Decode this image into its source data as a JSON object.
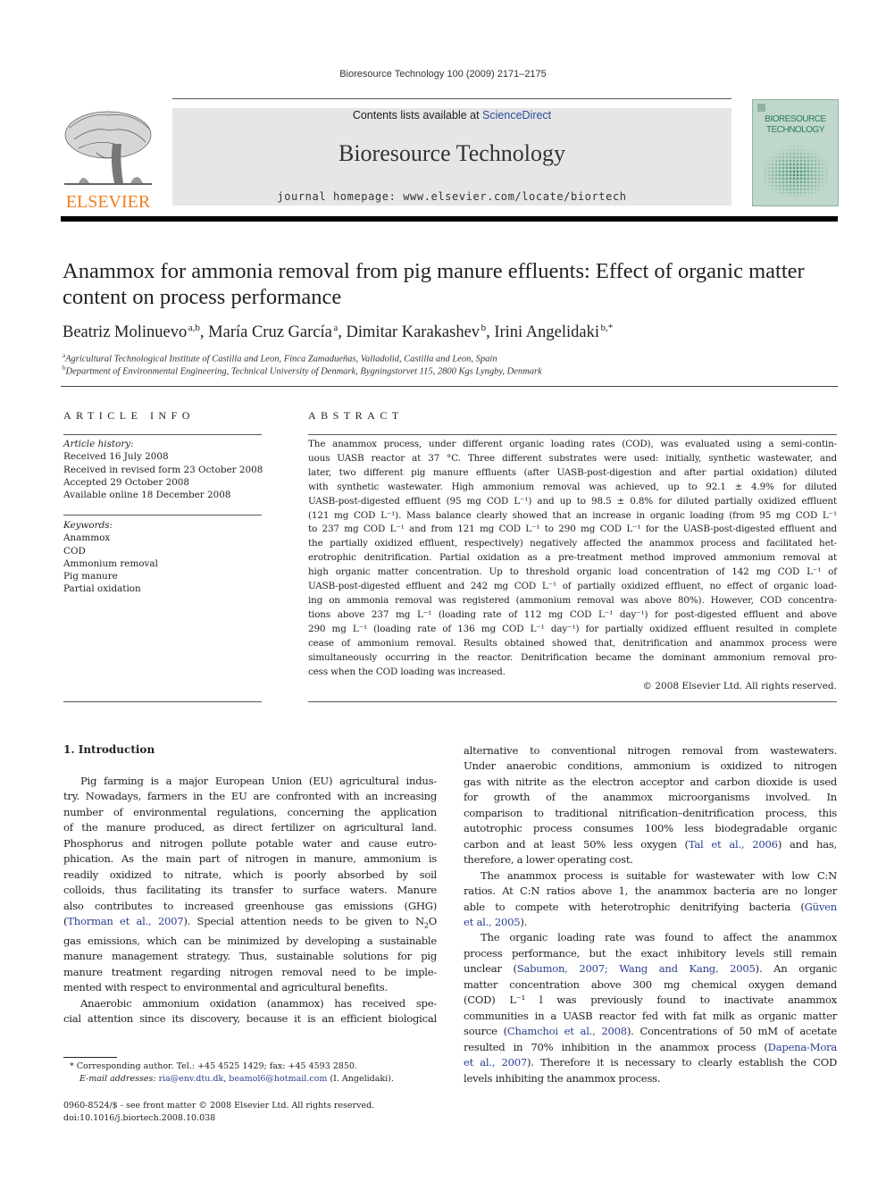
{
  "running_head": "Bioresource Technology 100 (2009) 2171–2175",
  "masthead": {
    "contents_prefix": "Contents lists available at ",
    "contents_link": "ScienceDirect",
    "journal_name": "Bioresource Technology",
    "homepage": "journal homepage: www.elsevier.com/locate/biortech",
    "publisher_logo_text": "ELSEVIER",
    "cover_title_line1": "BIORESOURCE",
    "cover_title_line2": "TECHNOLOGY",
    "colors": {
      "elsevier_orange": "#f07f1d",
      "link_blue": "#2a4b9b",
      "cover_green": "#bfd8cb"
    }
  },
  "article": {
    "title": "Anammox for ammonia removal from pig manure effluents: Effect of organic matter content on process performance",
    "authors": [
      {
        "name": "Beatriz Molinuevo",
        "sup": "a,b",
        "sep": ", "
      },
      {
        "name": "María Cruz García",
        "sup": "a",
        "sep": ", "
      },
      {
        "name": "Dimitar Karakashev",
        "sup": "b",
        "sep": ", "
      },
      {
        "name": "Irini Angelidaki",
        "sup": "b,*",
        "sep": ""
      }
    ],
    "affiliations": [
      {
        "mark": "a",
        "text": "Agricultural Technological Institute of Castilla and Leon, Finca Zamadueñas, Valladolid, Castilla and Leon, Spain"
      },
      {
        "mark": "b",
        "text": "Department of Environmental Engineering, Technical University of Denmark, Bygningstorvet 115, 2800 Kgs Lyngby, Denmark"
      }
    ]
  },
  "article_info": {
    "label": "ARTICLE INFO",
    "history_label": "Article history:",
    "history": [
      "Received 16 July 2008",
      "Received in revised form 23 October 2008",
      "Accepted 29 October 2008",
      "Available online 18 December 2008"
    ],
    "keywords_label": "Keywords:",
    "keywords": [
      "Anammox",
      "COD",
      "Ammonium removal",
      "Pig manure",
      "Partial oxidation"
    ]
  },
  "abstract": {
    "label": "ABSTRACT",
    "lines": [
      "The anammox process, under different organic loading rates (COD), was evaluated using a semi-contin-",
      "uous UASB reactor at 37 °C. Three different substrates were used: initially, synthetic wastewater, and",
      "later, two different pig manure effluents (after UASB-post-digestion and after partial oxidation) diluted",
      "with synthetic wastewater. High ammonium removal was achieved, up to 92.1 ± 4.9% for diluted",
      "UASB-post-digested effluent (95 mg COD L⁻¹) and up to 98.5 ± 0.8% for diluted partially oxidized effluent",
      "(121 mg COD L⁻¹). Mass balance clearly showed that an increase in organic loading (from 95 mg COD L⁻¹",
      "to 237 mg COD L⁻¹ and from 121 mg COD L⁻¹ to 290 mg COD L⁻¹ for the UASB-post-digested effluent and",
      "the partially oxidized effluent, respectively) negatively affected the anammox process and facilitated het-",
      "erotrophic denitrification. Partial oxidation as a pre-treatment method improved ammonium removal at",
      "high organic matter concentration. Up to threshold organic load concentration of 142 mg COD L⁻¹ of",
      "UASB-post-digested effluent and 242 mg COD L⁻¹ of partially oxidized effluent, no effect of organic load-",
      "ing on ammonia removal was registered (ammonium removal was above 80%). However, COD concentra-",
      "tions above 237 mg L⁻¹ (loading rate of 112 mg COD L⁻¹ day⁻¹) for post-digested effluent and above",
      "290 mg L⁻¹ (loading rate of 136 mg COD L⁻¹ day⁻¹) for partially oxidized effluent resulted in complete",
      "cease of ammonium removal. Results obtained showed that, denitrification and anammox process were",
      "simultaneously occurring in the reactor. Denitrification became the dominant ammonium removal pro-",
      "cess when the COD loading was increased."
    ],
    "copyright": "© 2008 Elsevier Ltd. All rights reserved."
  },
  "introduction": {
    "heading": "1. Introduction",
    "left_column": {
      "p1_lines": [
        "Pig farming is a major European Union (EU) agricultural indus-",
        "try. Nowadays, farmers in the EU are confronted with an increasing",
        "number of environmental regulations, concerning the application",
        "of the manure produced, as direct fertilizer on agricultural land.",
        "Phosphorus and nitrogen pollute potable water and cause eutro-",
        "phication. As the main part of nitrogen in manure, ammonium is",
        "readily oxidized to nitrate, which is poorly absorbed by soil",
        "colloids, thus facilitating its transfer to surface waters. Manure",
        "also contributes to increased greenhouse gas emissions (GHG)"
      ],
      "p1_cite": "Thorman et al., 2007",
      "p1_after_cite": "). Special attention needs to be given to N",
      "p1_sub": "2",
      "p1_after_sub": "O",
      "p1_rest_lines": [
        "gas emissions, which can be minimized by developing a sustainable",
        "manure management strategy. Thus, sustainable solutions for pig",
        "manure treatment regarding nitrogen removal need to be imple-",
        "mented with respect to environmental and agricultural benefits."
      ],
      "p2_lines": [
        "Anaerobic ammonium oxidation (anammox) has received spe-",
        "cial attention since its discovery, because it is an efficient biological"
      ]
    },
    "right_column": {
      "p1_lines": [
        "alternative to conventional nitrogen removal from wastewaters.",
        "Under anaerobic conditions, ammonium is oxidized to nitrogen",
        "gas with nitrite as the electron acceptor and carbon dioxide is used",
        "for growth of the anammox microorganisms involved. In",
        "comparison to traditional nitrification–denitrification process, this",
        "autotrophic process consumes 100% less biodegradable organic"
      ],
      "p1_line7_pre": "carbon and at least 50% less oxygen (",
      "p1_cite": "Tal et al., 2006",
      "p1_line7_post": ") and has,",
      "p1_line8": "therefore, a lower operating cost.",
      "p2_line1": "The anammox process is suitable for wastewater with low C:N",
      "p2_line2": "ratios. At C:N ratios above 1, the anammox bacteria are no longer",
      "p2_line3_pre": "able to compete with heterotrophic denitrifying bacteria (",
      "p2_cite_a": "Güven",
      "p2_cite_b": "et al., 2005",
      "p2_end": ").",
      "p3_line1": "The organic loading rate was found to affect the anammox",
      "p3_line2": "process performance, but the exact inhibitory levels still remain",
      "p3_line3_pre": "unclear (",
      "p3_cite1": "Sabumon, 2007; Wang and Kang, 2005",
      "p3_line3_post": "). An organic",
      "p3_line4": "matter concentration above 300 mg chemical oxygen demand",
      "p3_line5": "(COD) L⁻¹ l was previously found to inactivate anammox",
      "p3_line6": "communities in a UASB reactor fed with fat milk as organic matter",
      "p3_line7_pre": "source (",
      "p3_cite2": "Chamchoi et al., 2008",
      "p3_line7_post": "). Concentrations of 50 mM of acetate",
      "p3_line8_pre": "resulted in 70% inhibition in the anammox process (",
      "p3_cite3a": "Dapena-Mora",
      "p3_cite3b": "et al., 2007",
      "p3_line9_post": "). Therefore it is necessary to clearly establish the COD",
      "p3_line10": "levels inhibiting the anammox process."
    }
  },
  "footnotes": {
    "corresponding": "* Corresponding author. Tel.: +45 4525 1429; fax: +45 4593 2850.",
    "email_label": "E-mail addresses: ",
    "email1": "ria@env.dtu.dk",
    "email_sep": ", ",
    "email2": "beamol6@hotmail.com",
    "email_owner": " (I. Angelidaki).",
    "issn": "0960-8524/$ - see front matter © 2008 Elsevier Ltd. All rights reserved.",
    "doi": "doi:10.1016/j.biortech.2008.10.038"
  }
}
